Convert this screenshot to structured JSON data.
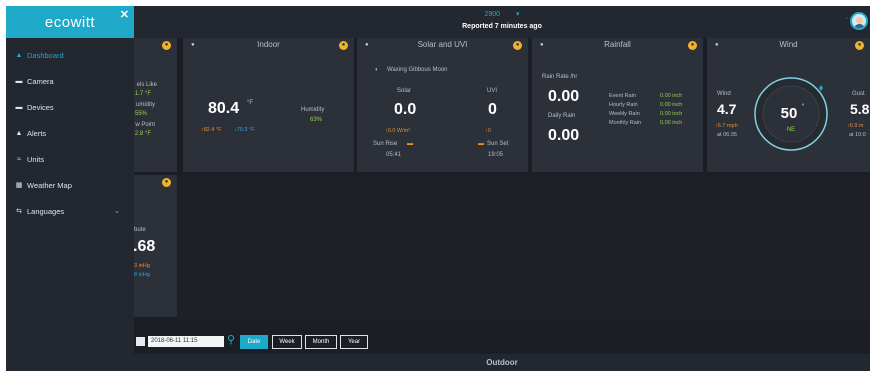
{
  "sidebar": {
    "logo": "ecowitt",
    "close": "✕",
    "items": [
      {
        "label": "Dashboard",
        "icon": "▲"
      },
      {
        "label": "Camera",
        "icon": "▬"
      },
      {
        "label": "Devices",
        "icon": "▬"
      },
      {
        "label": "Alerts",
        "icon": "▲"
      },
      {
        "label": "Units",
        "icon": "≈"
      },
      {
        "label": "Weather Map",
        "icon": "▦"
      },
      {
        "label": "Languages",
        "icon": "⇆",
        "caret": "⌄"
      }
    ]
  },
  "header": {
    "station": "2900",
    "caret": "▾",
    "reported": "Reported 7 minutes ago",
    "dots": "·",
    "avatar_icon": "user-avatar"
  },
  "outdoor_card": {
    "badge": "●",
    "dew_like_label": "els Like",
    "dew_like_value": "1.7 °F",
    "humidity_label": "umidity",
    "humidity_value": "55%",
    "dew_label": "w Point",
    "dew_value": "2.8 °F"
  },
  "indoor": {
    "title": "Indoor",
    "temp": "80.4",
    "temp_unit": "°F",
    "high": "↑82.4 °F",
    "low": "↓79.3 °F",
    "humidity_label": "Humidity",
    "humidity_value": "63%"
  },
  "solar": {
    "title": "Solar and UVI",
    "moon": "Waxing Gibbous Moon",
    "solar_label": "Solar",
    "solar_value": "0.0",
    "solar_high": "↑0.0 W/m²",
    "uvi_label": "UVI",
    "uvi_value": "0",
    "uvi_high": "↑0",
    "sunrise_label": "Sun Rise",
    "sunrise_time": "05:41",
    "sunset_label": "Sun Set",
    "sunset_time": "19:05"
  },
  "rainfall": {
    "title": "Rainfall",
    "rate_label": "Rain Rate /hr",
    "rate_value": "0.00",
    "daily_label": "Daily Rain",
    "daily_value": "0.00",
    "rows": [
      {
        "label": "Event Rain",
        "value": "0.00 inch"
      },
      {
        "label": "Hourly Rain",
        "value": "0.00 inch"
      },
      {
        "label": "Weekly Rain",
        "value": "0.00 inch"
      },
      {
        "label": "Monthly Rain",
        "value": "0.00 inch"
      }
    ]
  },
  "wind": {
    "title": "Wind",
    "wind_label": "Wind",
    "wind_value": "4.7",
    "wind_high": "↑6.7 mph",
    "wind_time": "at 06:35",
    "direction_deg": "50",
    "direction_unit": "°",
    "direction_name": "NE",
    "gust_label": "Gust",
    "gust_value": "5.8",
    "gust_high": "↑6.9 m",
    "gust_time": "at 10:0"
  },
  "pressure_card": {
    "badge": "●",
    "label": "bute",
    "value": ".68",
    "high": "3 inHg",
    "low": "8 inHg"
  },
  "datebar": {
    "date": "2018-06-11 11:15",
    "buttons": [
      "Date",
      "Week",
      "Month",
      "Year"
    ]
  },
  "section": {
    "outdoor": "Outdoor"
  }
}
